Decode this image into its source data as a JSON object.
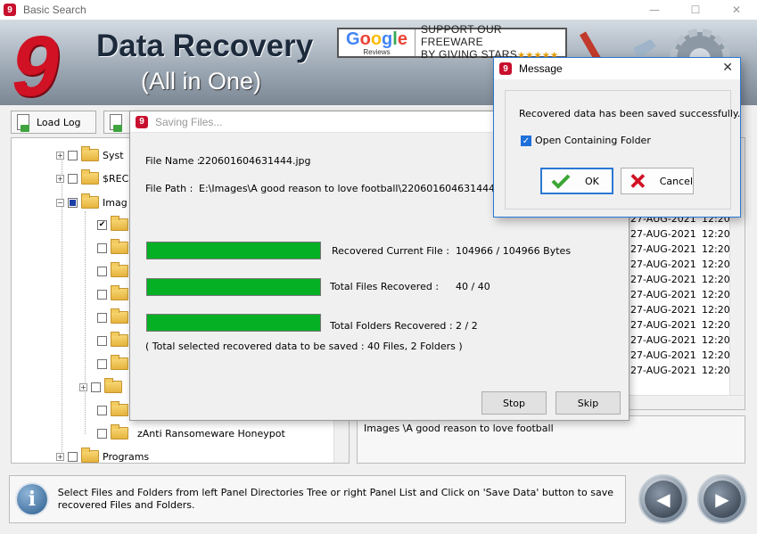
{
  "window": {
    "title": "Basic Search",
    "app_icon": "data-recovery-icon",
    "min": "—",
    "max": "☐",
    "close": "✕"
  },
  "banner": {
    "brand": "Data Recovery",
    "subtitle": "(All in One)",
    "google": {
      "word": "Google",
      "reviews": "Reviews",
      "line1": "SUPPORT OUR FREEWARE",
      "line2": "BY GIVING STARS",
      "stars": "★★★★★"
    }
  },
  "toolbar": {
    "load_log": "Load Log"
  },
  "tree": {
    "items": [
      {
        "label": "Syst",
        "expander": "+",
        "check": "none"
      },
      {
        "label": "$REC",
        "expander": "+",
        "check": "none"
      },
      {
        "label": "Imag",
        "expander": "−",
        "check": "partial"
      },
      {
        "label": "",
        "expander": "",
        "check": "checked"
      },
      {
        "label": "",
        "expander": "",
        "check": "none"
      },
      {
        "label": "",
        "expander": "",
        "check": "none"
      },
      {
        "label": "",
        "expander": "",
        "check": "none"
      },
      {
        "label": "",
        "expander": "",
        "check": "none"
      },
      {
        "label": "",
        "expander": "",
        "check": "none"
      },
      {
        "label": "",
        "expander": "",
        "check": "none"
      },
      {
        "label": "",
        "expander": "+",
        "check": "none"
      },
      {
        "label": "",
        "expander": "",
        "check": "none"
      },
      {
        "label": "zAnti Ransomeware Honeypot",
        "expander": "",
        "check": "none"
      },
      {
        "label": "Programs",
        "expander": "+",
        "check": "none"
      }
    ]
  },
  "list": {
    "rows": [
      {
        "date": "27-AUG-2021",
        "time": "12:20"
      },
      {
        "date": "27-AUG-2021",
        "time": "12:20"
      },
      {
        "date": "27-AUG-2021",
        "time": "12:20"
      },
      {
        "date": "27-AUG-2021",
        "time": "12:20"
      },
      {
        "date": "27-AUG-2021",
        "time": "12:20"
      },
      {
        "date": "27-AUG-2021",
        "time": "12:20"
      },
      {
        "date": "27-AUG-2021",
        "time": "12:20"
      },
      {
        "date": "27-AUG-2021",
        "time": "12:20"
      },
      {
        "date": "27-AUG-2021",
        "time": "12:20"
      },
      {
        "date": "27-AUG-2021",
        "time": "12:20"
      },
      {
        "date": "27-AUG-2021",
        "time": "12:20"
      }
    ]
  },
  "path_panel": {
    "text": "Images \\A good reason to love football"
  },
  "status": {
    "text": "Select Files and Folders from left Panel Directories Tree or right Panel List and Click on 'Save Data' button to save recovered Files and Folders."
  },
  "saving": {
    "title": "Saving Files...",
    "file_name_label": "File Name :",
    "file_name": "220601604631444.jpg",
    "file_path_label": "File Path :",
    "file_path": "E:\\Images\\A good reason to love football\\220601604631444.jpg",
    "current_label": "Recovered Current File :",
    "current_value": "104966 / 104966 Bytes",
    "files_label": "Total Files Recovered :",
    "files_value": "40 / 40",
    "folders_label": "Total Folders Recovered :",
    "folders_value": "2 / 2",
    "summary": "( Total selected recovered data to be saved : 40 Files, 2 Folders )",
    "progress": {
      "current": 1.0,
      "files": 1.0,
      "folders": 1.0
    },
    "stop": "Stop",
    "skip": "Skip"
  },
  "message": {
    "title": "Message",
    "close": "✕",
    "text": "Recovered data has been saved successfully.",
    "checkbox_label": "Open Containing Folder",
    "checkbox_checked": true,
    "ok": "OK",
    "cancel": "Cancel"
  },
  "colors": {
    "accent": "#2b78d4",
    "progress": "#06b025",
    "brand_red": "#d11224"
  }
}
